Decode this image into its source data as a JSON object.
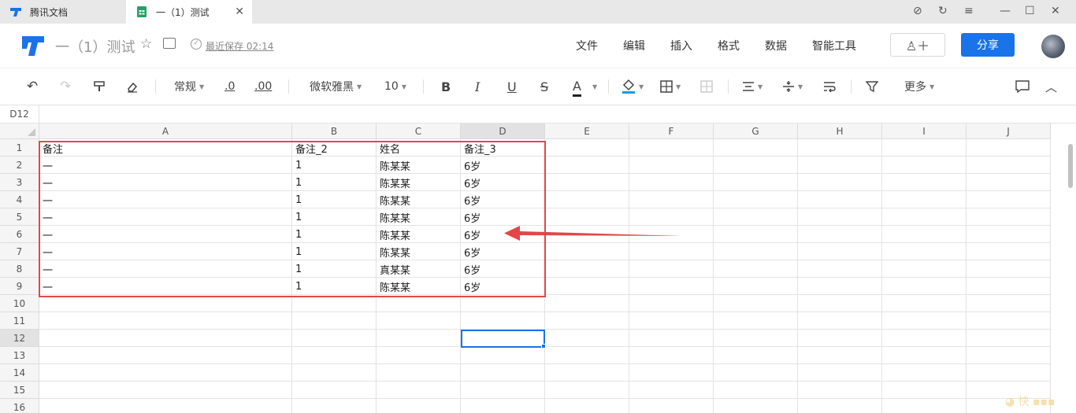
{
  "window": {
    "tabs": [
      {
        "label": "腾讯文档",
        "active": false
      },
      {
        "label": "一（1）测试",
        "active": true
      }
    ],
    "tab_close_glyph": "✕",
    "controls": [
      "⊘",
      "↻",
      "≡",
      "—",
      "☐",
      "✕"
    ]
  },
  "header": {
    "doc_title": "一（1）测试",
    "save_status": "最近保存 02:14",
    "menus": [
      "文件",
      "编辑",
      "插入",
      "格式",
      "数据",
      "智能工具"
    ],
    "add_user_glyph": "♙＋",
    "share_label": "分享"
  },
  "toolbar": {
    "format": "常规",
    "dec_decrease": ".0",
    "dec_increase": ".00",
    "font": "微软雅黑",
    "font_size": "10",
    "more": "更多"
  },
  "name_box": "D12",
  "sheet": {
    "columns": [
      "A",
      "B",
      "C",
      "D",
      "E",
      "F",
      "G",
      "H",
      "I",
      "J"
    ],
    "rows": [
      "1",
      "2",
      "3",
      "4",
      "5",
      "6",
      "7",
      "8",
      "9",
      "10",
      "11",
      "12",
      "13",
      "14",
      "15",
      "16"
    ],
    "selected_column": "D",
    "selected_row": "12",
    "cells": [
      [
        "备注",
        "备注_2",
        "姓名",
        "备注_3"
      ],
      [
        "一",
        "1",
        "陈某某",
        "6岁"
      ],
      [
        "一",
        "1",
        "陈某某",
        "6岁"
      ],
      [
        "一",
        "1",
        "陈某某",
        "6岁"
      ],
      [
        "一",
        "1",
        "陈某某",
        "6岁"
      ],
      [
        "一",
        "1",
        "陈某某",
        "6岁"
      ],
      [
        "一",
        "1",
        "陈某某",
        "6岁"
      ],
      [
        "一",
        "1",
        "真某某",
        "6岁"
      ],
      [
        "一",
        "1",
        "陈某某",
        "6岁"
      ]
    ]
  },
  "colors": {
    "accent": "#1a73e8",
    "annotation": "#e04848"
  }
}
